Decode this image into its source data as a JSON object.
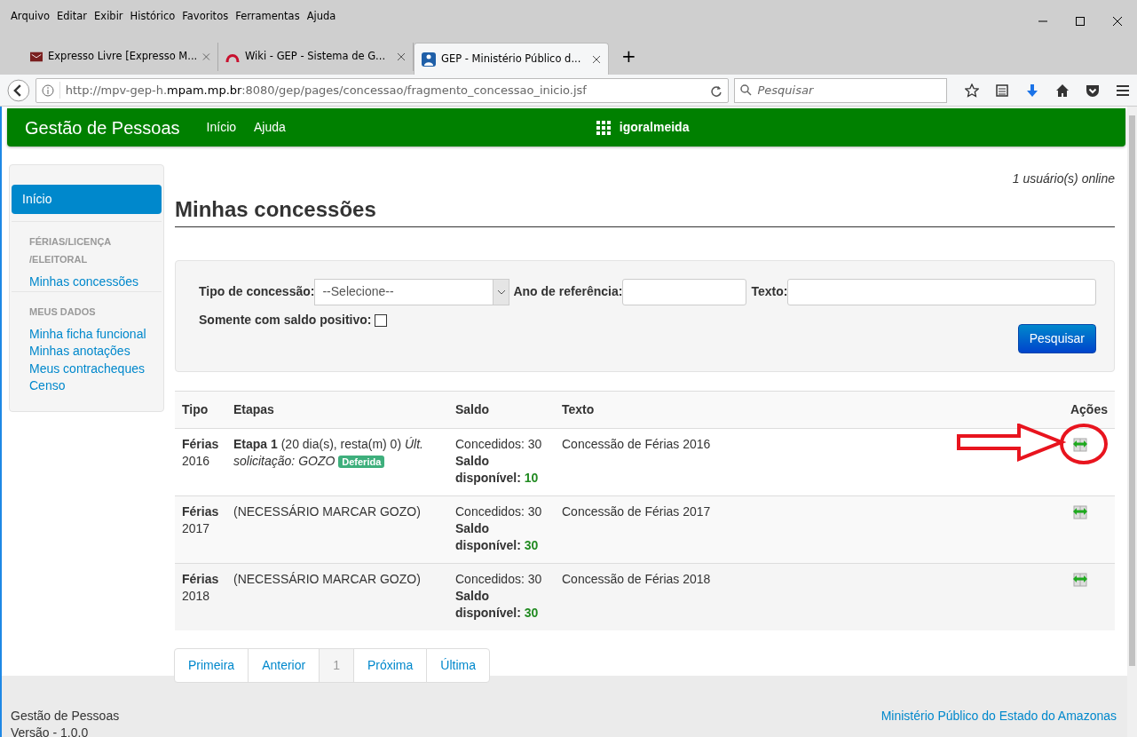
{
  "window": {
    "menu": [
      "Arquivo",
      "Editar",
      "Exibir",
      "Histórico",
      "Favoritos",
      "Ferramentas",
      "Ajuda"
    ],
    "tabs": [
      {
        "title": "Expresso Livre [Expresso M...",
        "kind": "mail",
        "selected": false
      },
      {
        "title": "Wiki - GEP - Sistema de G...",
        "kind": "arch",
        "selected": false
      },
      {
        "title": "GEP - Ministério Público d...",
        "kind": "person",
        "selected": true
      }
    ],
    "new_tab": "+",
    "address": {
      "prefix": "http://mpv-gep-h.",
      "domain": "mpam.mp.br",
      "suffix": ":8080/gep/pages/concessao/fragmento_concessao_inicio.jsf"
    },
    "search": {
      "placeholder": "Pesquisar"
    }
  },
  "navbar": {
    "brand": "Gestão de Pessoas",
    "links": [
      "Início",
      "Ajuda"
    ],
    "user": "igoralmeida"
  },
  "sidebar": {
    "items": [
      {
        "kind": "link",
        "label": "Início",
        "selected": true
      },
      {
        "kind": "header",
        "label": "FÉRIAS/LICENÇA /ELEITORAL"
      },
      {
        "kind": "link",
        "label": "Minhas concessões",
        "selected": false
      },
      {
        "kind": "header",
        "label": "MEUS DADOS"
      },
      {
        "kind": "link",
        "label": "Minha ficha funcional",
        "selected": false
      },
      {
        "kind": "link",
        "label": "Minhas anotações",
        "selected": false
      },
      {
        "kind": "link",
        "label": "Meus contracheques",
        "selected": false
      },
      {
        "kind": "link",
        "label": "Censo",
        "selected": false
      }
    ]
  },
  "online": "1 usuário(s) online",
  "heading": "Minhas concessões",
  "filters": {
    "tipo_label": "Tipo de concessão:",
    "tipo_value": "--Selecione--",
    "ano_label": "Ano de referência:",
    "texto_label": "Texto:",
    "saldo_label": "Somente com saldo positivo:",
    "saldo_checked": false,
    "button": "Pesquisar"
  },
  "table": {
    "columns": [
      "Tipo",
      "Etapas",
      "Saldo",
      "Texto",
      "Ações"
    ],
    "rows": [
      {
        "tipo": "Férias",
        "ano": "2016",
        "etapas": "**Etapa 1** (20 dia(s), resta(m) 0) *Últ. solicitação: GOZO*",
        "badge": "Deferida",
        "concedidos": "Concedidos: 30",
        "saldo_label": "Saldo disponível:",
        "saldo_value": "10",
        "texto": "Concessão de Férias 2016",
        "highlighted": true
      },
      {
        "tipo": "Férias",
        "ano": "2017",
        "etapas": "(NECESSÁRIO MARCAR GOZO)",
        "concedidos": "Concedidos: 30",
        "saldo_label": "Saldo disponível:",
        "saldo_value": "30",
        "texto": "Concessão de Férias 2017",
        "highlighted": false
      },
      {
        "tipo": "Férias",
        "ano": "2018",
        "etapas": "(NECESSÁRIO MARCAR GOZO)",
        "concedidos": "Concedidos: 30",
        "saldo_label": "Saldo disponível:",
        "saldo_value": "30",
        "texto": "Concessão de Férias 2018",
        "highlighted": false
      }
    ]
  },
  "pagination": [
    {
      "label": "Primeira",
      "selected": false
    },
    {
      "label": "Anterior",
      "selected": false
    },
    {
      "label": "1",
      "selected": true
    },
    {
      "label": "Próxima",
      "selected": false
    },
    {
      "label": "Última",
      "selected": false
    }
  ],
  "footer": {
    "app": "Gestão de Pessoas",
    "version": "Versão - 1.0.0",
    "org": "Ministério Público do Estado do Amazonas"
  }
}
